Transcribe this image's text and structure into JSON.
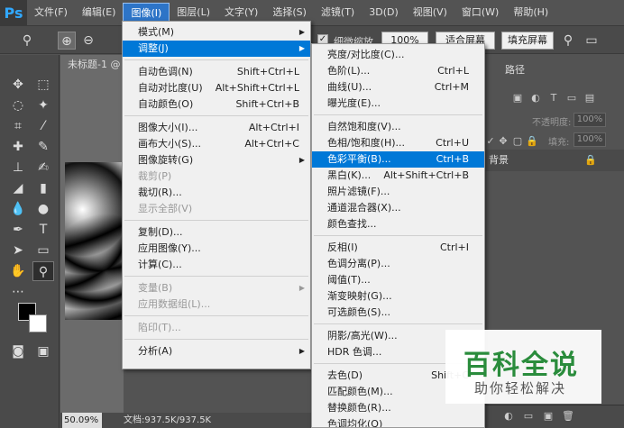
{
  "app": {
    "logo": "Ps"
  },
  "menubar": {
    "items": [
      "文件(F)",
      "编辑(E)",
      "图像(I)",
      "图层(L)",
      "文字(Y)",
      "选择(S)",
      "滤镜(T)",
      "3D(D)",
      "视图(V)",
      "窗口(W)",
      "帮助(H)"
    ]
  },
  "optbar": {
    "zoom_icons": [
      "🔍",
      "⊕",
      "⊖"
    ],
    "fine_zoom_label": "细微缩放",
    "btn_100": "100%",
    "btn_fit": "适合屏幕",
    "btn_fill": "填充屏幕"
  },
  "document": {
    "tab_title": "未标题-1 @",
    "status_zoom": "50.09%",
    "status_doc": "文档:937.5K/937.5K"
  },
  "panel": {
    "tab_paths": "路径",
    "opacity_label": "不透明度:",
    "opacity_value": "100%",
    "fill_label": "填充:",
    "fill_value": "100%",
    "layer_name": "背景"
  },
  "image_menu": {
    "items": [
      {
        "label": "模式(M)",
        "shortcut": "",
        "submenu": true,
        "disabled": false
      },
      {
        "label": "调整(J)",
        "shortcut": "",
        "submenu": true,
        "disabled": false,
        "highlight": true
      },
      {
        "label": "自动色调(N)",
        "shortcut": "Shift+Ctrl+L"
      },
      {
        "label": "自动对比度(U)",
        "shortcut": "Alt+Shift+Ctrl+L"
      },
      {
        "label": "自动颜色(O)",
        "shortcut": "Shift+Ctrl+B"
      },
      {
        "label": "图像大小(I)...",
        "shortcut": "Alt+Ctrl+I"
      },
      {
        "label": "画布大小(S)...",
        "shortcut": "Alt+Ctrl+C"
      },
      {
        "label": "图像旋转(G)",
        "shortcut": "",
        "submenu": true
      },
      {
        "label": "裁剪(P)",
        "shortcut": "",
        "disabled": true
      },
      {
        "label": "裁切(R)...",
        "shortcut": ""
      },
      {
        "label": "显示全部(V)",
        "shortcut": "",
        "disabled": true
      },
      {
        "label": "复制(D)...",
        "shortcut": ""
      },
      {
        "label": "应用图像(Y)...",
        "shortcut": ""
      },
      {
        "label": "计算(C)...",
        "shortcut": ""
      },
      {
        "label": "变量(B)",
        "shortcut": "",
        "submenu": true,
        "disabled": true
      },
      {
        "label": "应用数据组(L)...",
        "shortcut": "",
        "disabled": true
      },
      {
        "label": "陷印(T)...",
        "shortcut": "",
        "disabled": true
      },
      {
        "label": "分析(A)",
        "shortcut": "",
        "submenu": true
      }
    ]
  },
  "adjust_submenu": {
    "items": [
      {
        "label": "亮度/对比度(C)...",
        "shortcut": ""
      },
      {
        "label": "色阶(L)...",
        "shortcut": "Ctrl+L"
      },
      {
        "label": "曲线(U)...",
        "shortcut": "Ctrl+M"
      },
      {
        "label": "曝光度(E)...",
        "shortcut": ""
      },
      {
        "label": "自然饱和度(V)...",
        "shortcut": ""
      },
      {
        "label": "色相/饱和度(H)...",
        "shortcut": "Ctrl+U"
      },
      {
        "label": "色彩平衡(B)...",
        "shortcut": "Ctrl+B",
        "highlight": true
      },
      {
        "label": "黑白(K)...",
        "shortcut": "Alt+Shift+Ctrl+B"
      },
      {
        "label": "照片滤镜(F)...",
        "shortcut": ""
      },
      {
        "label": "通道混合器(X)...",
        "shortcut": ""
      },
      {
        "label": "颜色查找...",
        "shortcut": ""
      },
      {
        "label": "反相(I)",
        "shortcut": "Ctrl+I"
      },
      {
        "label": "色调分离(P)...",
        "shortcut": ""
      },
      {
        "label": "阈值(T)...",
        "shortcut": ""
      },
      {
        "label": "渐变映射(G)...",
        "shortcut": ""
      },
      {
        "label": "可选颜色(S)...",
        "shortcut": ""
      },
      {
        "label": "阴影/高光(W)...",
        "shortcut": ""
      },
      {
        "label": "HDR 色调...",
        "shortcut": ""
      },
      {
        "label": "去色(D)",
        "shortcut": "Shift+C"
      },
      {
        "label": "匹配颜色(M)...",
        "shortcut": ""
      },
      {
        "label": "替换颜色(R)...",
        "shortcut": ""
      },
      {
        "label": "色调均化(Q)",
        "shortcut": ""
      }
    ]
  },
  "watermark": {
    "title": "百科全说",
    "subtitle": "助你轻松解决"
  },
  "colors": {
    "highlight": "#0078d7",
    "ps_blue": "#31a8ff",
    "watermark_green": "#2a8c3c"
  }
}
